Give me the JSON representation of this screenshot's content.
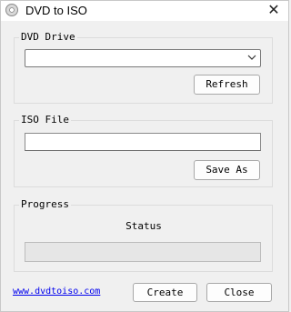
{
  "window": {
    "title": "DVD to ISO",
    "close_glyph": "✕"
  },
  "dvd_drive": {
    "label": "DVD Drive",
    "selected_value": "",
    "refresh_label": "Refresh"
  },
  "iso_file": {
    "label": "ISO File",
    "path_value": "",
    "save_as_label": "Save As"
  },
  "progress": {
    "label": "Progress",
    "status_text": "Status",
    "value": 0
  },
  "footer": {
    "link_text": "www.dvdtoiso.com",
    "create_label": "Create",
    "close_label": "Close"
  }
}
